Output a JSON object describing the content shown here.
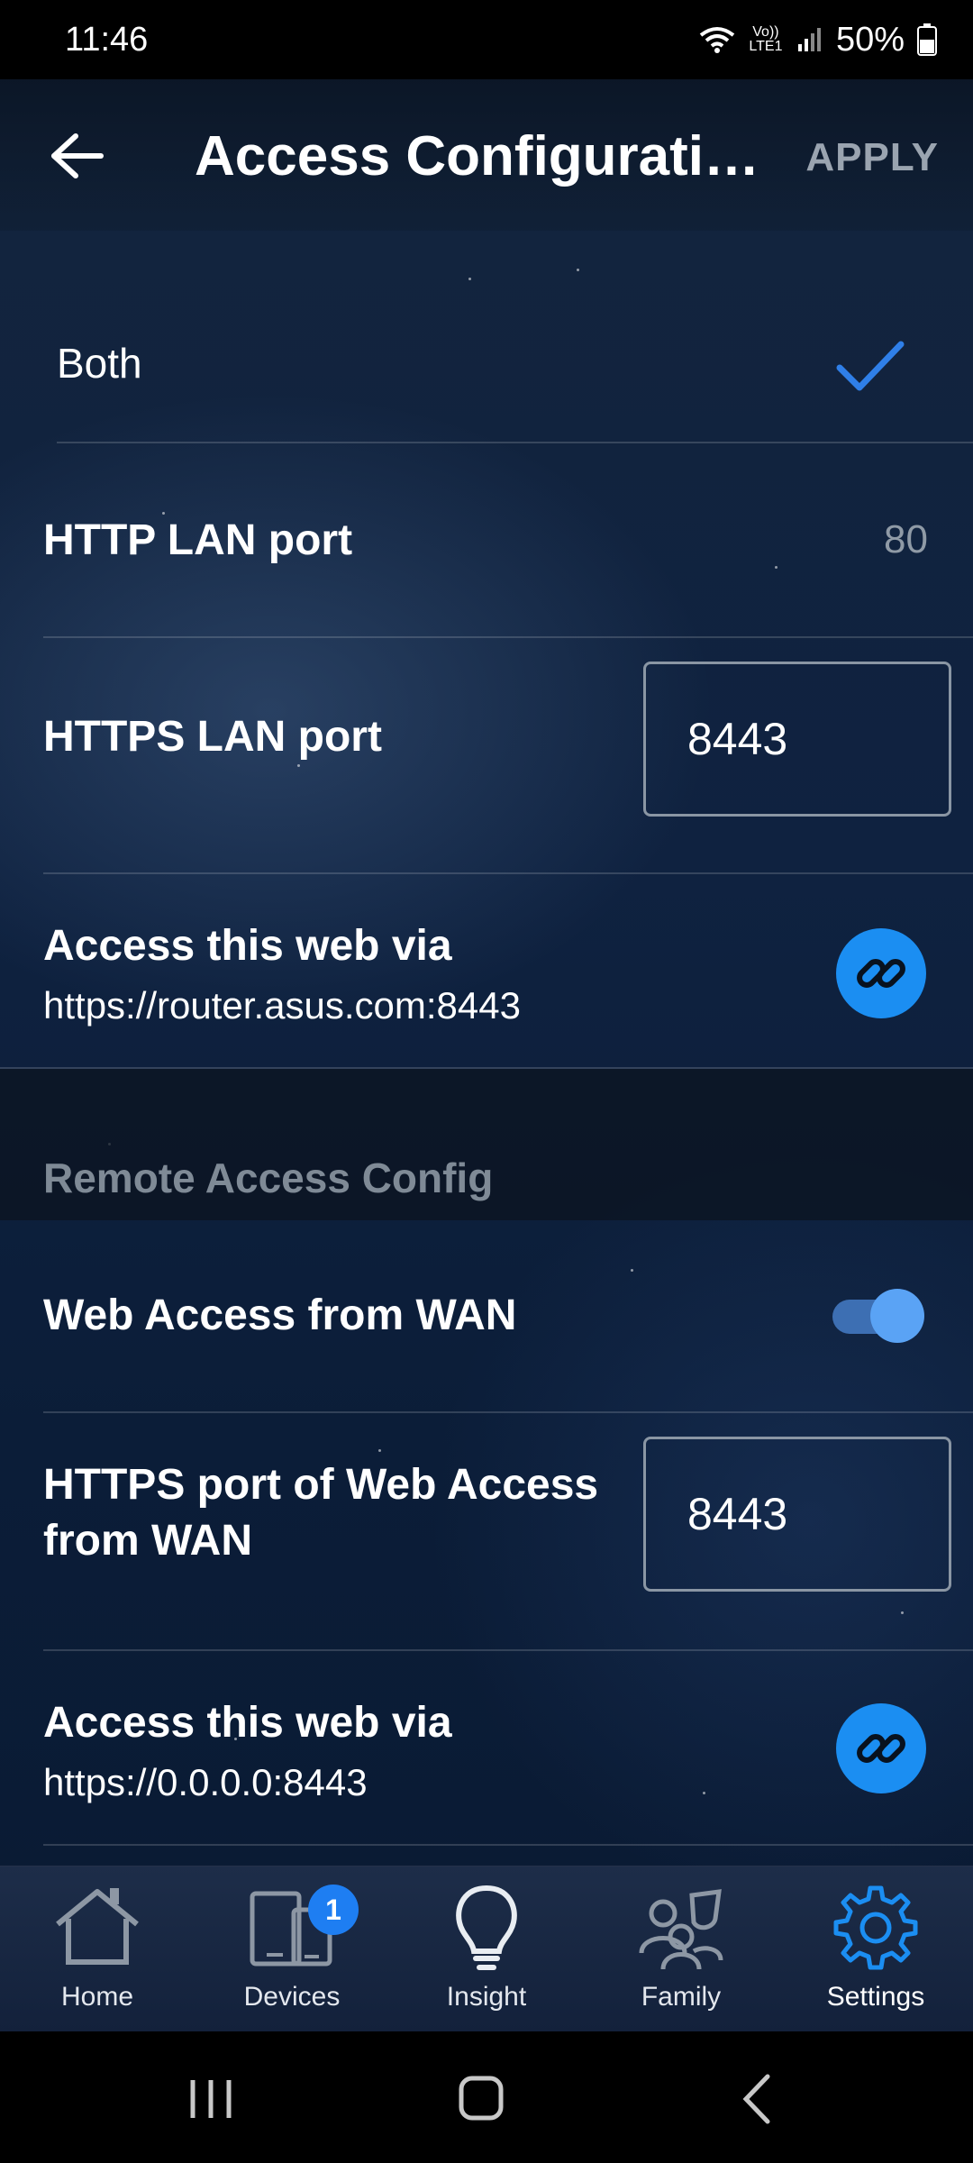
{
  "status_bar": {
    "time": "11:46",
    "network_label": "Vo)) LTE1",
    "battery": "50%"
  },
  "header": {
    "title": "Access Configurati…",
    "apply_label": "APPLY"
  },
  "local_access": {
    "selected_option": "Both",
    "http_lan_port_label": "HTTP LAN port",
    "http_lan_port_value": "80",
    "https_lan_port_label": "HTTPS LAN port",
    "https_lan_port_value": "8443",
    "access_via_label": "Access this web via",
    "access_via_url": "https://router.asus.com:8443"
  },
  "remote_access": {
    "section_title": "Remote Access Config",
    "wan_access_label": "Web Access from WAN",
    "wan_access_enabled": true,
    "https_wan_port_label_line1": "HTTPS port of Web Access",
    "https_wan_port_label_line2": "from WAN",
    "https_wan_port_value": "8443",
    "access_via_label": "Access this web via",
    "access_via_url": "https://0.0.0.0:8443"
  },
  "bottom_nav": {
    "items": [
      {
        "label": "Home",
        "icon": "home-icon"
      },
      {
        "label": "Devices",
        "icon": "devices-icon",
        "badge": "1"
      },
      {
        "label": "Insight",
        "icon": "lightbulb-icon"
      },
      {
        "label": "Family",
        "icon": "family-icon"
      },
      {
        "label": "Settings",
        "icon": "gear-icon",
        "active": true
      }
    ]
  },
  "colors": {
    "accent": "#1b8ef2",
    "check": "#2f7fe8",
    "muted_text": "#8f9aa6"
  }
}
